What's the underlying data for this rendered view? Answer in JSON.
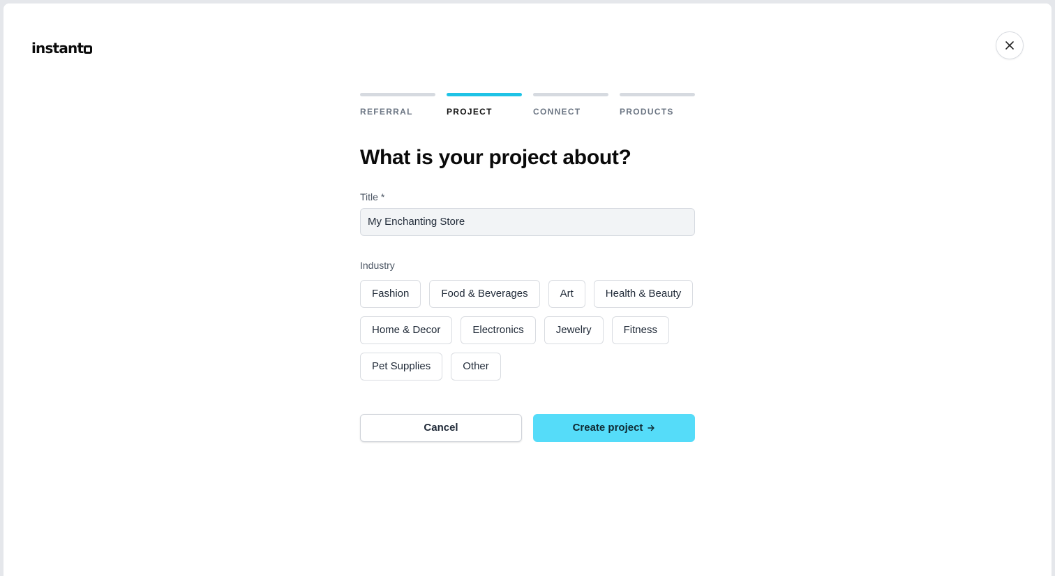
{
  "brand": {
    "name": "instant"
  },
  "steps": [
    {
      "label": "REFERRAL",
      "active": false
    },
    {
      "label": "PROJECT",
      "active": true
    },
    {
      "label": "CONNECT",
      "active": false
    },
    {
      "label": "PRODUCTS",
      "active": false
    }
  ],
  "form": {
    "heading": "What is your project about?",
    "title_label": "Title *",
    "title_value": "My Enchanting Store",
    "industry_label": "Industry",
    "industries": [
      "Fashion",
      "Food & Beverages",
      "Art",
      "Health & Beauty",
      "Home & Decor",
      "Electronics",
      "Jewelry",
      "Fitness",
      "Pet Supplies",
      "Other"
    ]
  },
  "actions": {
    "cancel_label": "Cancel",
    "create_label": "Create project"
  },
  "icons": {
    "close": "close-icon",
    "arrow": "arrow-right-icon",
    "logo": "logo-mark-icon"
  },
  "colors": {
    "accent": "#1fc3e6",
    "primary_button": "#55dcf9",
    "inactive_step": "#d6dae0"
  }
}
